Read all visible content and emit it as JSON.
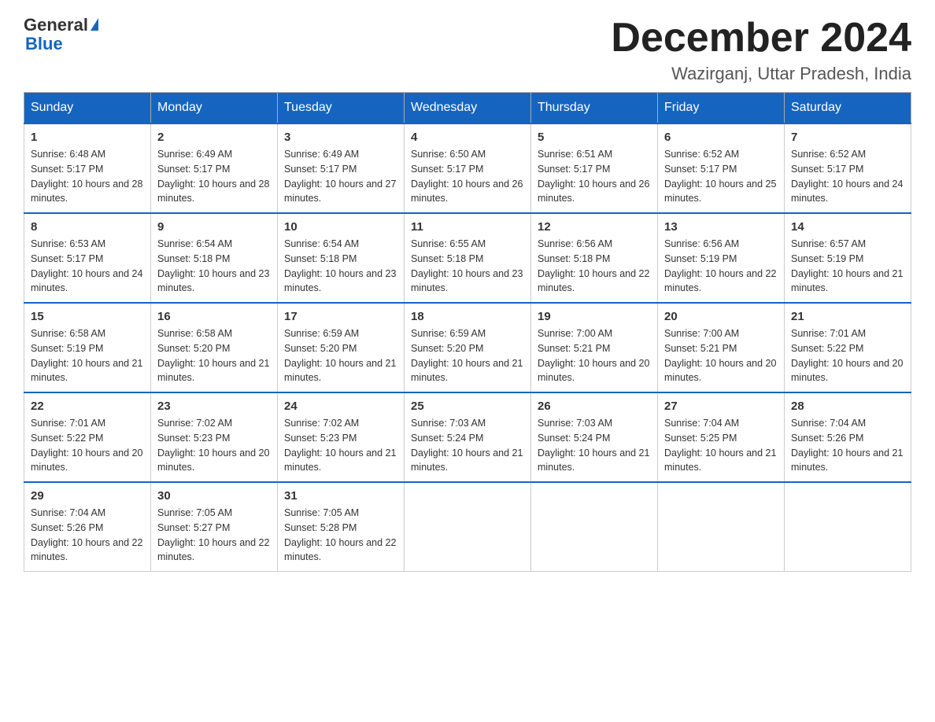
{
  "header": {
    "logo_general": "General",
    "logo_blue": "Blue",
    "title": "December 2024",
    "location": "Wazirganj, Uttar Pradesh, India"
  },
  "days_of_week": [
    "Sunday",
    "Monday",
    "Tuesday",
    "Wednesday",
    "Thursday",
    "Friday",
    "Saturday"
  ],
  "weeks": [
    [
      {
        "day": "1",
        "sunrise": "6:48 AM",
        "sunset": "5:17 PM",
        "daylight": "10 hours and 28 minutes."
      },
      {
        "day": "2",
        "sunrise": "6:49 AM",
        "sunset": "5:17 PM",
        "daylight": "10 hours and 28 minutes."
      },
      {
        "day": "3",
        "sunrise": "6:49 AM",
        "sunset": "5:17 PM",
        "daylight": "10 hours and 27 minutes."
      },
      {
        "day": "4",
        "sunrise": "6:50 AM",
        "sunset": "5:17 PM",
        "daylight": "10 hours and 26 minutes."
      },
      {
        "day": "5",
        "sunrise": "6:51 AM",
        "sunset": "5:17 PM",
        "daylight": "10 hours and 26 minutes."
      },
      {
        "day": "6",
        "sunrise": "6:52 AM",
        "sunset": "5:17 PM",
        "daylight": "10 hours and 25 minutes."
      },
      {
        "day": "7",
        "sunrise": "6:52 AM",
        "sunset": "5:17 PM",
        "daylight": "10 hours and 24 minutes."
      }
    ],
    [
      {
        "day": "8",
        "sunrise": "6:53 AM",
        "sunset": "5:17 PM",
        "daylight": "10 hours and 24 minutes."
      },
      {
        "day": "9",
        "sunrise": "6:54 AM",
        "sunset": "5:18 PM",
        "daylight": "10 hours and 23 minutes."
      },
      {
        "day": "10",
        "sunrise": "6:54 AM",
        "sunset": "5:18 PM",
        "daylight": "10 hours and 23 minutes."
      },
      {
        "day": "11",
        "sunrise": "6:55 AM",
        "sunset": "5:18 PM",
        "daylight": "10 hours and 23 minutes."
      },
      {
        "day": "12",
        "sunrise": "6:56 AM",
        "sunset": "5:18 PM",
        "daylight": "10 hours and 22 minutes."
      },
      {
        "day": "13",
        "sunrise": "6:56 AM",
        "sunset": "5:19 PM",
        "daylight": "10 hours and 22 minutes."
      },
      {
        "day": "14",
        "sunrise": "6:57 AM",
        "sunset": "5:19 PM",
        "daylight": "10 hours and 21 minutes."
      }
    ],
    [
      {
        "day": "15",
        "sunrise": "6:58 AM",
        "sunset": "5:19 PM",
        "daylight": "10 hours and 21 minutes."
      },
      {
        "day": "16",
        "sunrise": "6:58 AM",
        "sunset": "5:20 PM",
        "daylight": "10 hours and 21 minutes."
      },
      {
        "day": "17",
        "sunrise": "6:59 AM",
        "sunset": "5:20 PM",
        "daylight": "10 hours and 21 minutes."
      },
      {
        "day": "18",
        "sunrise": "6:59 AM",
        "sunset": "5:20 PM",
        "daylight": "10 hours and 21 minutes."
      },
      {
        "day": "19",
        "sunrise": "7:00 AM",
        "sunset": "5:21 PM",
        "daylight": "10 hours and 20 minutes."
      },
      {
        "day": "20",
        "sunrise": "7:00 AM",
        "sunset": "5:21 PM",
        "daylight": "10 hours and 20 minutes."
      },
      {
        "day": "21",
        "sunrise": "7:01 AM",
        "sunset": "5:22 PM",
        "daylight": "10 hours and 20 minutes."
      }
    ],
    [
      {
        "day": "22",
        "sunrise": "7:01 AM",
        "sunset": "5:22 PM",
        "daylight": "10 hours and 20 minutes."
      },
      {
        "day": "23",
        "sunrise": "7:02 AM",
        "sunset": "5:23 PM",
        "daylight": "10 hours and 20 minutes."
      },
      {
        "day": "24",
        "sunrise": "7:02 AM",
        "sunset": "5:23 PM",
        "daylight": "10 hours and 21 minutes."
      },
      {
        "day": "25",
        "sunrise": "7:03 AM",
        "sunset": "5:24 PM",
        "daylight": "10 hours and 21 minutes."
      },
      {
        "day": "26",
        "sunrise": "7:03 AM",
        "sunset": "5:24 PM",
        "daylight": "10 hours and 21 minutes."
      },
      {
        "day": "27",
        "sunrise": "7:04 AM",
        "sunset": "5:25 PM",
        "daylight": "10 hours and 21 minutes."
      },
      {
        "day": "28",
        "sunrise": "7:04 AM",
        "sunset": "5:26 PM",
        "daylight": "10 hours and 21 minutes."
      }
    ],
    [
      {
        "day": "29",
        "sunrise": "7:04 AM",
        "sunset": "5:26 PM",
        "daylight": "10 hours and 22 minutes."
      },
      {
        "day": "30",
        "sunrise": "7:05 AM",
        "sunset": "5:27 PM",
        "daylight": "10 hours and 22 minutes."
      },
      {
        "day": "31",
        "sunrise": "7:05 AM",
        "sunset": "5:28 PM",
        "daylight": "10 hours and 22 minutes."
      },
      null,
      null,
      null,
      null
    ]
  ]
}
